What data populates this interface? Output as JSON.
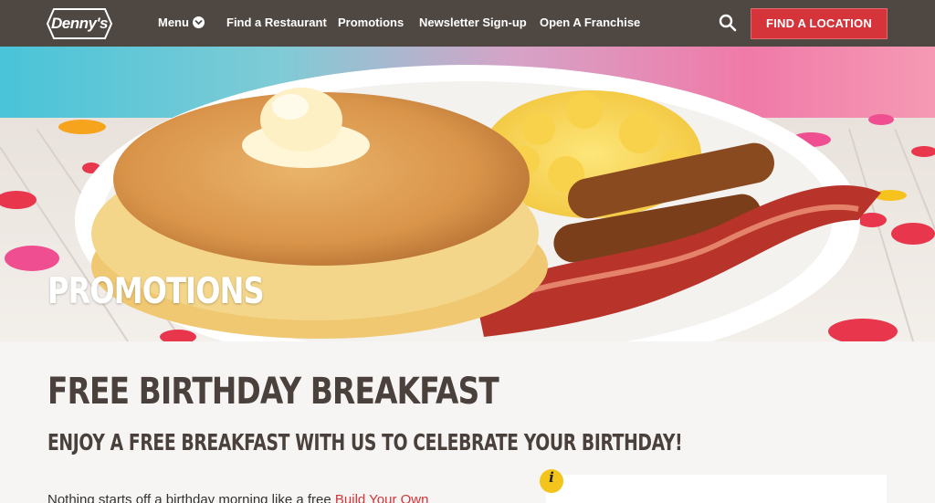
{
  "brand": {
    "logo_text": "Denny's"
  },
  "nav": {
    "menu": "Menu",
    "find_restaurant": "Find a Restaurant",
    "promotions": "Promotions",
    "newsletter": "Newsletter Sign-up",
    "franchise": "Open A Franchise",
    "cta": "FIND A LOCATION"
  },
  "hero": {
    "title": "PROMOTIONS"
  },
  "main": {
    "title": "FREE BIRTHDAY BREAKFAST",
    "subtitle": "ENJOY A FREE BREAKFAST WITH US TO CELEBRATE YOUR BIRTHDAY!",
    "body_prefix": "Nothing starts off a birthday morning like a free ",
    "body_link": "Build Your Own",
    "info_icon_label": "i"
  },
  "colors": {
    "nav_bg": "#4f4742",
    "accent_red": "#d4343a",
    "info_yellow": "#f3c41c",
    "heading": "#4a413c"
  },
  "icons": {
    "search": "search-icon",
    "menu_chevron": "chevron-down-icon",
    "info": "info-icon"
  }
}
